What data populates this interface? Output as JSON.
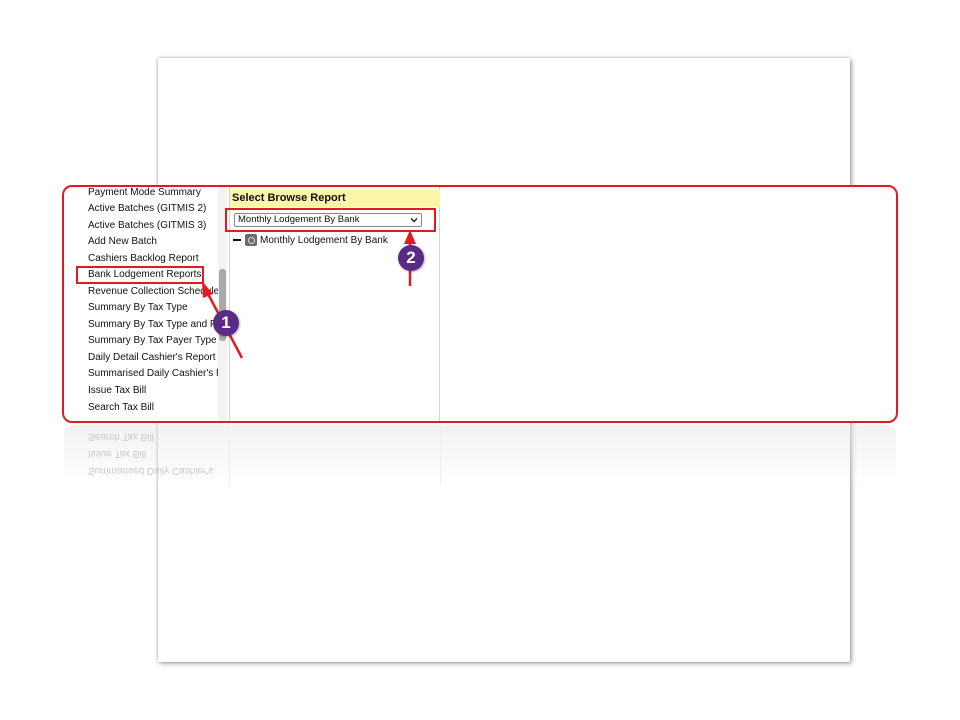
{
  "sidebar": {
    "items": [
      "Payment Mode Summary",
      "Active Batches (GITMIS 2)",
      "Active Batches (GITMIS 3)",
      "Add New Batch",
      "Cashiers Backlog Report",
      "Bank Lodgement Reports",
      "Revenue Collection Schedule",
      "Summary By Tax Type",
      "Summary By Tax Type and Period",
      "Summary By Tax Payer Type",
      "Daily Detail Cashier's Report",
      "Summarised Daily Cashier's Report",
      "Issue Tax Bill",
      "Search Tax Bill"
    ],
    "selected": "Bank Lodgement Reports"
  },
  "report_panel": {
    "header": "Select Browse Report",
    "select_value": "Monthly Lodgement By Bank",
    "tree_item": "Monthly Lodgement By Bank"
  },
  "reflection": {
    "lines": [
      "Search Tax Bill",
      "Issue Tax Bill",
      "Summarised Daily Cashier's"
    ]
  },
  "callouts": {
    "step1": "1",
    "step2": "2",
    "color": "#e01b24",
    "badge_color": "#5b2a86"
  }
}
